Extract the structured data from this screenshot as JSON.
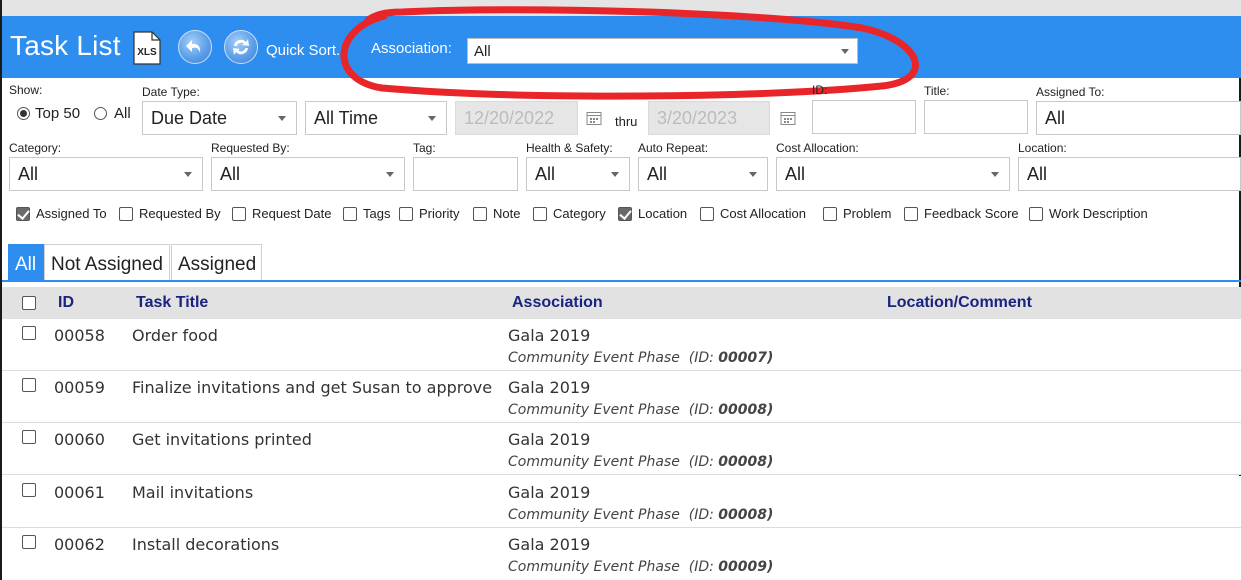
{
  "header": {
    "title": "Task List",
    "xls_label": "XLS",
    "quick_sort_label": "Quick Sort...",
    "association_label": "Association:",
    "association_value": "All",
    "bg_color": "#2e8ef0",
    "annotation_color": "#e8262a"
  },
  "filters": {
    "show_label": "Show:",
    "show_options": [
      "Top 50",
      "All"
    ],
    "show_selected": "Top 50",
    "date_type_label": "Date Type:",
    "date_type_value": "Due Date",
    "date_range_value": "All Time",
    "date_from": "12/20/2022",
    "thru_label": "thru",
    "date_to": "3/20/2023",
    "id_label": "ID:",
    "id_value": "",
    "title_label": "Title:",
    "title_value": "",
    "assigned_to_label": "Assigned To:",
    "assigned_to_value": "All",
    "category_label": "Category:",
    "category_value": "All",
    "requested_by_label": "Requested By:",
    "requested_by_value": "All",
    "tag_label": "Tag:",
    "tag_value": "",
    "health_safety_label": "Health & Safety:",
    "health_safety_value": "All",
    "auto_repeat_label": "Auto Repeat:",
    "auto_repeat_value": "All",
    "cost_allocation_label": "Cost Allocation:",
    "cost_allocation_value": "All",
    "location_label": "Location:",
    "location_value": "All"
  },
  "columns_toggle": [
    {
      "label": "Assigned To",
      "checked": true
    },
    {
      "label": "Requested By",
      "checked": false
    },
    {
      "label": "Request Date",
      "checked": false
    },
    {
      "label": "Tags",
      "checked": false
    },
    {
      "label": "Priority",
      "checked": false
    },
    {
      "label": "Note",
      "checked": false
    },
    {
      "label": "Category",
      "checked": false
    },
    {
      "label": "Location",
      "checked": true
    },
    {
      "label": "Cost Allocation",
      "checked": false
    },
    {
      "label": "Problem",
      "checked": false
    },
    {
      "label": "Feedback Score",
      "checked": false
    },
    {
      "label": "Work Description",
      "checked": false
    }
  ],
  "tabs": [
    {
      "label": "All",
      "active": true
    },
    {
      "label": "Not Assigned",
      "active": false
    },
    {
      "label": "Assigned",
      "active": false
    }
  ],
  "table": {
    "headers": {
      "id": "ID",
      "title": "Task Title",
      "association": "Association",
      "location": "Location/Comment"
    },
    "rows": [
      {
        "id": "00058",
        "title": "Order food",
        "association": "Gala 2019",
        "phase": "Community Event Phase",
        "phase_id_label": "(ID:",
        "phase_id": "00007)"
      },
      {
        "id": "00059",
        "title": "Finalize invitations and get Susan to approve",
        "association": "Gala 2019",
        "phase": "Community Event Phase",
        "phase_id_label": "(ID:",
        "phase_id": "00008)"
      },
      {
        "id": "00060",
        "title": "Get invitations printed",
        "association": "Gala 2019",
        "phase": "Community Event Phase",
        "phase_id_label": "(ID:",
        "phase_id": "00008)"
      },
      {
        "id": "00061",
        "title": "Mail invitations",
        "association": "Gala 2019",
        "phase": "Community Event Phase",
        "phase_id_label": "(ID:",
        "phase_id": "00008)"
      },
      {
        "id": "00062",
        "title": "Install decorations",
        "association": "Gala 2019",
        "phase": "Community Event Phase",
        "phase_id_label": "(ID:",
        "phase_id": "00009)"
      }
    ]
  }
}
